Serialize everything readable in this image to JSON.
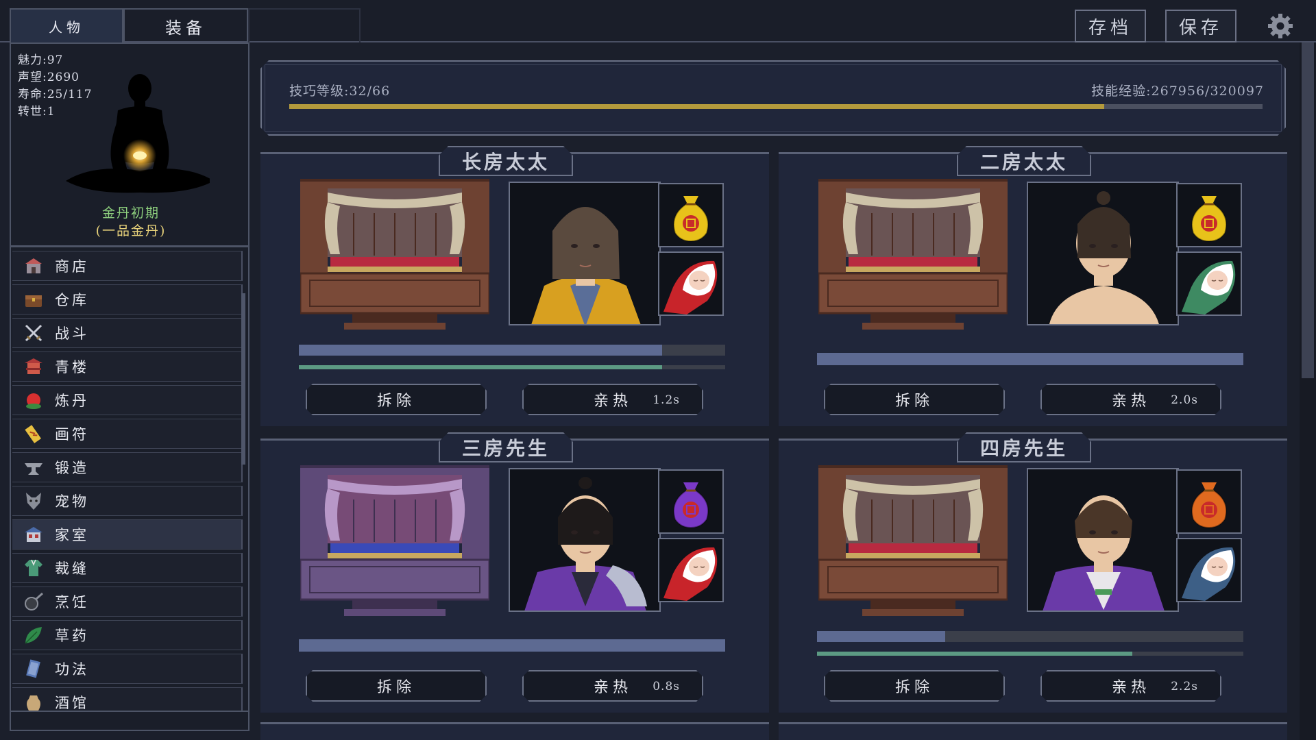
{
  "tabs": [
    {
      "label": "人物",
      "active": true
    },
    {
      "label": "装备",
      "active": false
    }
  ],
  "top_buttons": {
    "archive": "存档",
    "save": "保存"
  },
  "character": {
    "stats": [
      {
        "label": "魅力:",
        "value": "97"
      },
      {
        "label": "声望:",
        "value": "2690"
      },
      {
        "label": "寿命:",
        "value": "25/117"
      },
      {
        "label": "转世:",
        "value": "1"
      }
    ],
    "realm": "金丹初期",
    "realm_sub": "(一品金丹)"
  },
  "menu": [
    {
      "label": "商店",
      "icon": "shop-icon",
      "active": false
    },
    {
      "label": "仓库",
      "icon": "chest-icon",
      "active": false
    },
    {
      "label": "战斗",
      "icon": "crossed-swords-icon",
      "active": false
    },
    {
      "label": "青楼",
      "icon": "pavilion-icon",
      "active": false
    },
    {
      "label": "炼丹",
      "icon": "cauldron-icon",
      "active": false
    },
    {
      "label": "画符",
      "icon": "talisman-icon",
      "active": false
    },
    {
      "label": "锻造",
      "icon": "anvil-icon",
      "active": false
    },
    {
      "label": "宠物",
      "icon": "fox-mask-icon",
      "active": false
    },
    {
      "label": "家室",
      "icon": "house-icon",
      "active": true
    },
    {
      "label": "裁缝",
      "icon": "robe-icon",
      "active": false
    },
    {
      "label": "烹饪",
      "icon": "pan-icon",
      "active": false
    },
    {
      "label": "草药",
      "icon": "herb-leaf-icon",
      "active": false
    },
    {
      "label": "功法",
      "icon": "scroll-book-icon",
      "active": false
    },
    {
      "label": "酒馆",
      "icon": "wine-jar-icon",
      "active": false
    }
  ],
  "skill": {
    "level_label": "技巧等级:",
    "level_value": "32/66",
    "exp_label": "技能经验:",
    "exp_value": "267956/320097",
    "progress": 0.8371
  },
  "spouses": [
    {
      "title": "长房太太",
      "bed_theme": "red",
      "portrait": "woman-eyepatch-fur-collar",
      "bag_color": "#e8c21a",
      "baby_color": "#c8242a",
      "bar1": 0.852,
      "bar2": 0.852,
      "remove_label": "拆除",
      "intimate_label": "亲热",
      "timer": "1.2s"
    },
    {
      "title": "二房太太",
      "bed_theme": "red",
      "portrait": "woman-bare-shoulders",
      "bag_color": "#e8c21a",
      "baby_color": "#3e8a62",
      "bar1": 1.0,
      "bar2": null,
      "remove_label": "拆除",
      "intimate_label": "亲热",
      "timer": "2.0s"
    },
    {
      "title": "三房先生",
      "bed_theme": "purple",
      "portrait": "man-topknot-purple-robe",
      "bag_color": "#7b39c8",
      "baby_color": "#c8242a",
      "bar1": 1.0,
      "bar2": null,
      "remove_label": "拆除",
      "intimate_label": "亲热",
      "timer": "0.8s"
    },
    {
      "title": "四房先生",
      "bed_theme": "red",
      "portrait": "man-short-hair-purple-robe",
      "bag_color": "#e06a1f",
      "baby_color": "#3d5f86",
      "bar1": 0.3,
      "bar2": 0.74,
      "remove_label": "拆除",
      "intimate_label": "亲热",
      "timer": "2.2s"
    }
  ],
  "colors": {
    "bar_blue": "#5d6a92",
    "bar_green": "#5c9a83",
    "skill_gold": "#b49a3c",
    "realm_green": "#8ed07e",
    "realm_gold": "#e8d27a"
  }
}
